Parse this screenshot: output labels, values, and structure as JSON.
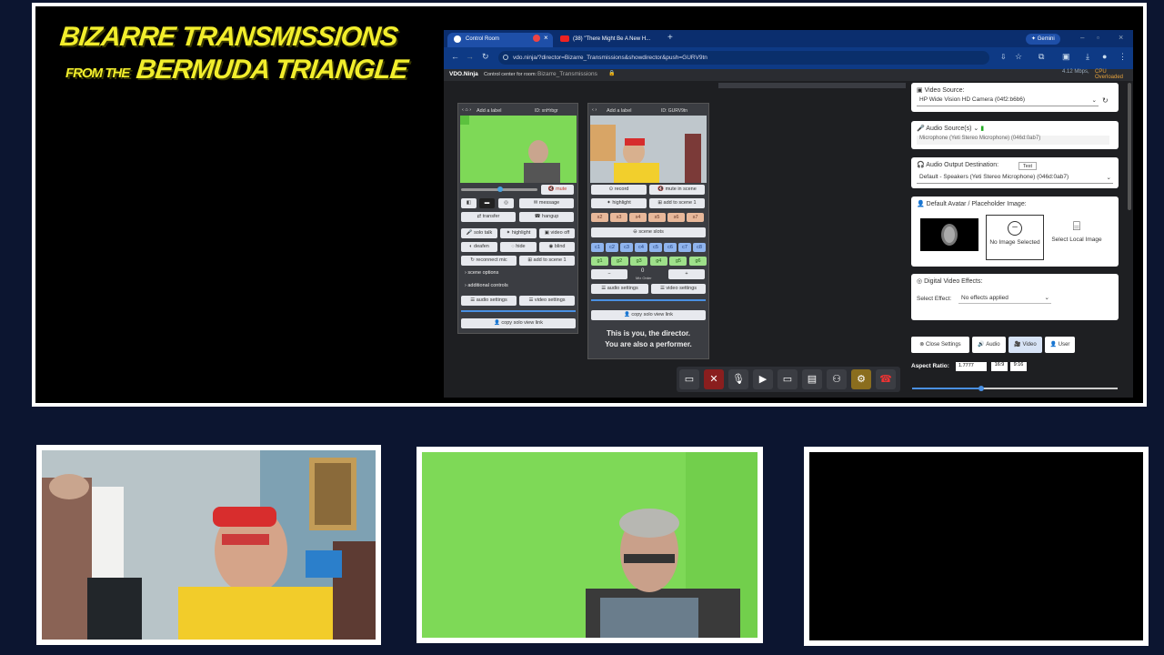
{
  "overlay": {
    "logo_line1": "BIZARRE TRANSMISSIONS",
    "logo_line2a": "FROM THE",
    "logo_line2b": "BERMUDA TRIANGLE"
  },
  "browser": {
    "tab1": "Control Room",
    "tab2": "(38) \"There Might Be A New H...",
    "gemini": "Gemini",
    "url": "vdo.ninja/?director=Bizarre_Transmissions&showdirector&push=GURV9tn",
    "brand": "VDO.Ninja",
    "room_label": "Control center for room:",
    "room_name": "Bizarre_Transmissions",
    "stats": "4.12 Mbps,",
    "cpu": "CPU Overloaded"
  },
  "guest1": {
    "label": "Add a label",
    "id": "ID: xnHrbgr",
    "mute": "mute",
    "message": "message",
    "transfer": "transfer",
    "hangup": "hangup",
    "solo_talk": "solo talk",
    "highlight": "highlight",
    "video_off": "video off",
    "deafen": "deafen",
    "hide": "hide",
    "blind": "blind",
    "reconnect": "reconnect mic",
    "add_scene": "add to scene 1",
    "scene_options": "scene options",
    "additional": "additional controls",
    "audio_settings": "audio settings",
    "video_settings": "video settings",
    "copy_solo": "copy solo view link"
  },
  "guest2": {
    "label": "Add a label",
    "id": "ID: GURV9tn",
    "record": "record",
    "mute_scene": "mute in scene",
    "highlight": "highlight",
    "add_scene": "add to scene 1",
    "scenes": [
      "s2",
      "s3",
      "s4",
      "s5",
      "s6",
      "s7"
    ],
    "scene_slots": "scene slots",
    "slots_c": [
      "c1",
      "c2",
      "c3",
      "c4",
      "c5",
      "c6",
      "c7",
      "c8"
    ],
    "slots_g": [
      "g1",
      "g2",
      "g3",
      "g4",
      "g5",
      "g6"
    ],
    "minus": "−",
    "zero": "0",
    "mix_order": "Mix Order",
    "plus": "+",
    "audio_settings": "audio settings",
    "video_settings": "video settings",
    "copy_solo": "copy solo view link",
    "director_note_1": "This is you, the director.",
    "director_note_2": "You are also a performer."
  },
  "settings": {
    "video_source_label": "Video Source:",
    "video_source": "HP Wide Vision HD Camera (04f2:b6b6)",
    "audio_source_label": "Audio Source(s)",
    "audio_source": "Microphone (Yeti Stereo Microphone) (046d:0ab7)",
    "audio_out_label": "Audio Output Destination:",
    "test": "Test",
    "audio_out": "Default - Speakers (Yeti Stereo Microphone) (046d:0ab7)",
    "avatar_label": "Default Avatar / Placeholder Image:",
    "no_image": "No Image Selected",
    "select_local": "Select Local Image",
    "effects_label": "Digital Video Effects:",
    "select_effect_label": "Select Effect:",
    "select_effect": "No effects applied",
    "close_settings": "Close Settings",
    "audio": "Audio",
    "video": "Video",
    "user": "User",
    "aspect_label": "Aspect Ratio:",
    "aspect_value": "1.7777",
    "ratio_169": "16:9",
    "ratio_916": "9:16"
  },
  "colors": {
    "background": "#0c1530",
    "logo": "#f2ee2c",
    "green_screen": "#7ed957",
    "tab_bar": "#0b2e6e",
    "hangup_red": "#c0392b"
  }
}
